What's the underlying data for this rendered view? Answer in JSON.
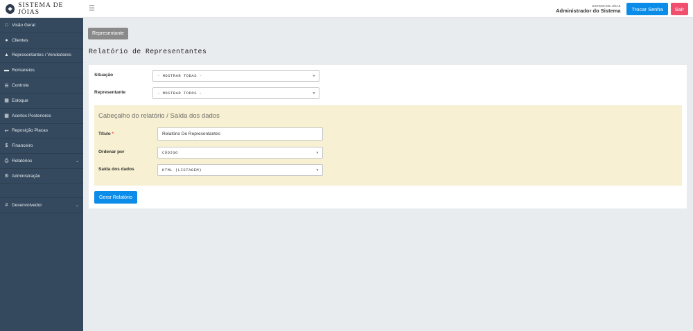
{
  "header": {
    "brand": "SISTEMA DE JÓIAS",
    "logo_icon": "gem-icon",
    "menu_icon": "hamburger-icon",
    "system_label": "SISTEMA DE JÓIAS",
    "user_name": "Administrador do Sistema",
    "change_password_label": "Trocar Senha",
    "logout_label": "Sair"
  },
  "sidebar": {
    "items": [
      {
        "label": "Visão Geral",
        "icon": "monitor-icon"
      },
      {
        "label": "Clientes",
        "icon": "users-icon"
      },
      {
        "label": "Representantes / Vendedores",
        "icon": "user-tie-icon"
      },
      {
        "label": "Romaneios",
        "icon": "truck-icon"
      },
      {
        "label": "Controle",
        "icon": "list-icon"
      },
      {
        "label": "Estoque",
        "icon": "grid-icon"
      },
      {
        "label": "Acertos Posteriores",
        "icon": "calendar-icon"
      },
      {
        "label": "Reposição Placas",
        "icon": "reply-icon"
      },
      {
        "label": "Financeiro",
        "icon": "dollar-icon"
      },
      {
        "label": "Relatórios",
        "icon": "print-icon"
      },
      {
        "label": "Administração",
        "icon": "gear-icon"
      },
      {
        "label": "Desenvolvedor",
        "icon": "hashtag-icon"
      }
    ]
  },
  "main": {
    "breadcrumb_button": "Representante",
    "page_title": "Relatório de Representantes",
    "filters": {
      "situacao_label": "Situação",
      "situacao_value": "- MOSTRAR TODAS -",
      "representante_label": "Representante",
      "representante_value": "- MOSTRAR TODOS -"
    },
    "output_section": {
      "title": "Cabeçalho do relatório / Saída dos dados",
      "titulo_label": "Título",
      "titulo_required": "*",
      "titulo_value": "Relatório De Representantes",
      "ordenar_label": "Ordenar por",
      "ordenar_value": "CÓDIGO",
      "saida_label": "Saída dos dados",
      "saida_value": "HTML (LISTAGEM)"
    },
    "generate_button": "Gerar Relatório"
  },
  "colors": {
    "sidebar_bg": "#34495e",
    "primary": "#0c8ce9",
    "danger": "#f0506e",
    "section_bg": "#f7f0d2"
  }
}
